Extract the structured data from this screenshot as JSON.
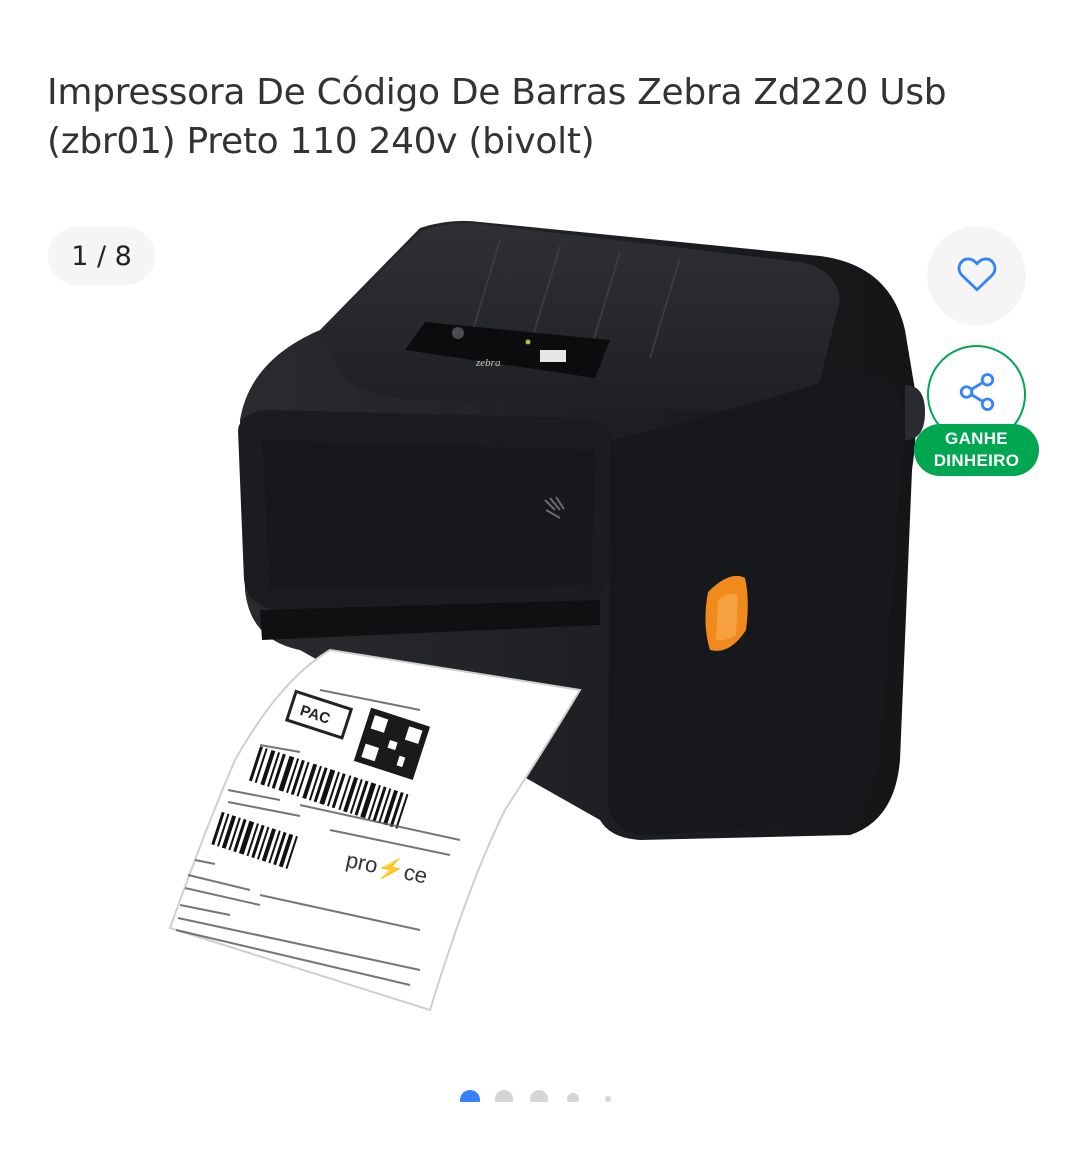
{
  "product": {
    "title": "Impressora De Código De Barras Zebra Zd220 Usb (zbr01) Preto 110 240v (bivolt)"
  },
  "gallery": {
    "counter": "1 / 8",
    "image_alt": "Zebra ZD220 label printer",
    "slides_total": 8,
    "active_slide": 1
  },
  "actions": {
    "favorite_icon": "heart-icon",
    "share_icon": "share-icon",
    "earn_line1": "GANHE",
    "earn_line2": "DINHEIRO"
  },
  "label_print": {
    "stamp": "PAC",
    "brand": "pro⚡ce"
  },
  "colors": {
    "accent_blue": "#3483fa",
    "earn_green": "#00a650",
    "printer_body": "#1f2023",
    "release_button": "#f08a1d"
  }
}
